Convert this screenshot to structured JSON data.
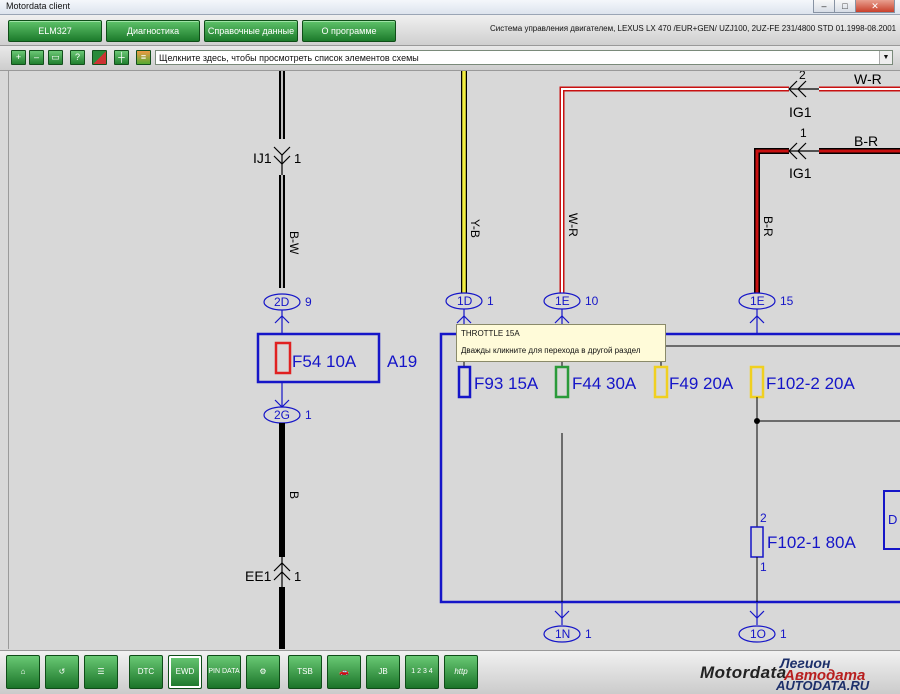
{
  "window": {
    "title": "Motordata client",
    "controls": {
      "minimize": "–",
      "maximize": "□",
      "close": "✕"
    }
  },
  "tabs": [
    {
      "label": "ELM327"
    },
    {
      "label": "Диагностика"
    },
    {
      "label": "Справочные данные"
    },
    {
      "label": "О программе"
    }
  ],
  "system_title": "Система управления двигателем, LEXUS  LX 470 /EUR+GEN/  UZJ100,   2UZ-FE  231/4800  STD  01.1998-08.2001",
  "toolbar": {
    "combo_text": "Щелкните здесь, чтобы просмотреть список элементов схемы",
    "icons": [
      "zoom-in-icon",
      "zoom-out-icon",
      "zoom-fit-icon",
      "help-icon",
      "color-mode-icon",
      "wire-mode-icon",
      "palette-icon"
    ]
  },
  "diagram": {
    "wires": [
      "B-W",
      "B",
      "Y-B",
      "W-R",
      "B-R",
      "W-R",
      "B-R"
    ],
    "connectors": {
      "ij1": {
        "name": "IJ1",
        "pin": "1"
      },
      "ee1": {
        "name": "EE1",
        "pin": "1"
      },
      "ig1_top": {
        "name": "IG1",
        "pin": "2"
      },
      "ig1_bottom": {
        "name": "IG1",
        "pin": "1"
      },
      "c2d": {
        "name": "2D",
        "pin": "9"
      },
      "c2g": {
        "name": "2G",
        "pin": "1"
      },
      "c1d": {
        "name": "1D",
        "pin": "1"
      },
      "c1e_a": {
        "name": "1E",
        "pin": "10"
      },
      "c1e_b": {
        "name": "1E",
        "pin": "15"
      },
      "c1n": {
        "name": "1N",
        "pin": "1"
      },
      "c1o": {
        "name": "1O",
        "pin": "1"
      }
    },
    "fuses": {
      "f54": "F54 10A",
      "f93": "F93 15A",
      "f44": "F44 30A",
      "f49": "F49 20A",
      "f102_2": "F102-2 20A",
      "f102_1": "F102-1 80A",
      "f102_1_pin_top": "2",
      "f102_1_pin_bottom": "1"
    },
    "block_label": "A19",
    "cut_label": "D"
  },
  "tooltip": {
    "title": "THROTTLE 15A",
    "hint": "Дважды кликните для перехода в другой раздел"
  },
  "bottom_toolbar": {
    "buttons": [
      {
        "name": "home-icon",
        "label": ""
      },
      {
        "name": "back-icon",
        "label": ""
      },
      {
        "name": "list-icon",
        "label": ""
      },
      {
        "name": "dtc-icon",
        "label": "DTC"
      },
      {
        "name": "ewd-icon",
        "label": "EWD"
      },
      {
        "name": "pin-data-icon",
        "label": "PIN DATA"
      },
      {
        "name": "tools-icon",
        "label": ""
      },
      {
        "name": "tsb-icon",
        "label": "TSB"
      },
      {
        "name": "vehicle-icon",
        "label": ""
      },
      {
        "name": "jb-icon",
        "label": "JB"
      },
      {
        "name": "codes-icon",
        "label": "1 2 3 4"
      },
      {
        "name": "web-icon",
        "label": "http"
      }
    ],
    "brand": "Motordata",
    "logo_lines": [
      "Легион",
      "Автодата",
      "AUTODATA.RU"
    ]
  }
}
